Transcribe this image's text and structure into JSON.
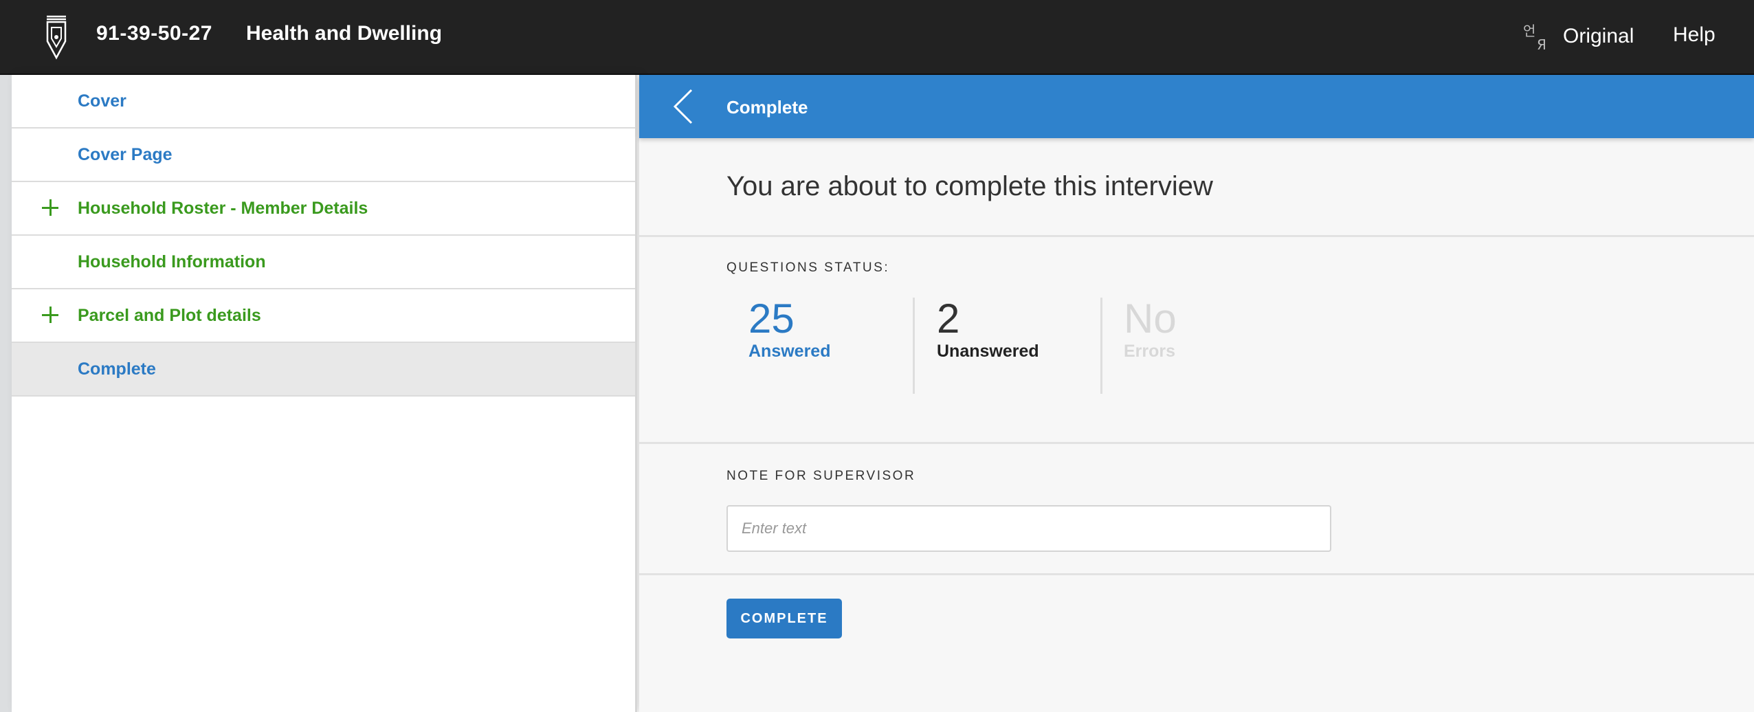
{
  "header": {
    "interview_id": "91-39-50-27",
    "survey_title": "Health and Dwelling",
    "language_label": "Original",
    "help_label": "Help",
    "logo_icon": "pen-nib-logo-icon",
    "language_icon": "translate-icon"
  },
  "sidebar": {
    "items": [
      {
        "label": "Cover",
        "color": "blue",
        "expandable": false,
        "active": false
      },
      {
        "label": "Cover Page",
        "color": "blue",
        "expandable": false,
        "active": false
      },
      {
        "label": "Household Roster - Member Details",
        "color": "green",
        "expandable": true,
        "active": false
      },
      {
        "label": "Household Information",
        "color": "green",
        "expandable": false,
        "active": false
      },
      {
        "label": "Parcel and Plot details",
        "color": "green",
        "expandable": true,
        "active": false
      },
      {
        "label": "Complete",
        "color": "blue",
        "expandable": false,
        "active": true
      }
    ]
  },
  "main": {
    "header_title": "Complete",
    "heading": "You are about to complete this interview",
    "questions_status_label": "QUESTIONS STATUS:",
    "stats": {
      "answered": {
        "value": "25",
        "label": "Answered"
      },
      "unanswered": {
        "value": "2",
        "label": "Unanswered"
      },
      "errors": {
        "value": "No",
        "label": "Errors"
      }
    },
    "note_label": "NOTE FOR SUPERVISOR",
    "note_placeholder": "Enter text",
    "note_value": "",
    "complete_button": "COMPLETE"
  },
  "colors": {
    "topbar": "#222222",
    "accent_blue": "#2f82cc",
    "link_blue": "#2b7ac4",
    "section_green": "#3a9a1e",
    "muted": "#d8d8d8"
  }
}
